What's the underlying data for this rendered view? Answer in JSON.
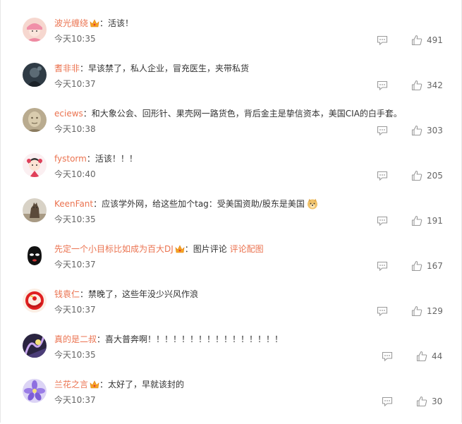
{
  "comments": [
    {
      "user": "波光缠绕",
      "vip": true,
      "colon": "：",
      "text": "活该！",
      "link": "",
      "link2": "",
      "time": "今天10:35",
      "likes": "491",
      "avatar": "avatar-girl-pink-hat"
    },
    {
      "user": "耆非非",
      "vip": false,
      "colon": "：",
      "text": "早该禁了，私人企业，冒充医生，夹带私货",
      "link": "",
      "link2": "",
      "time": "今天10:37",
      "likes": "342",
      "avatar": "avatar-dark-figure"
    },
    {
      "user": "eciews",
      "vip": false,
      "colon": "：",
      "text": "和大象公会、回形针、果壳网一路货色，背后金主是挚信资本，美国CIA的白手套。",
      "link": "",
      "link2": "",
      "time": "今天10:38",
      "likes": "303",
      "avatar": "avatar-sculpture-face"
    },
    {
      "user": "fystorm",
      "vip": false,
      "colon": "：",
      "text": "活该！！！",
      "link": "",
      "link2": "",
      "time": "今天10:40",
      "likes": "205",
      "avatar": "avatar-cartoon-girl"
    },
    {
      "user": "KeenFant",
      "vip": false,
      "colon": "：",
      "text": "应该学外网，给这些加个tag：受美国资助/股东是美国",
      "link": "",
      "link2": "",
      "time": "今天10:35",
      "likes": "191",
      "avatar": "avatar-cat-photo",
      "emoji": "doge-emoji"
    },
    {
      "user": "先定一个小目标比如成为百大DJ",
      "vip": true,
      "colon": "：",
      "text": "图片评论 ",
      "link": "评论配图",
      "link2": "",
      "time": "今天10:37",
      "likes": "167",
      "avatar": "avatar-masked-face"
    },
    {
      "user": "钱袁仁",
      "vip": false,
      "colon": "：",
      "text": "禁晚了，这些年没少兴风作浪",
      "link": "",
      "link2": "",
      "time": "今天10:37",
      "likes": "129",
      "avatar": "avatar-red-logo"
    },
    {
      "user": "真的是二叔",
      "vip": false,
      "colon": "：",
      "text": "喜大普奔啊！！！！！！！！！！！！！！！！",
      "link": "",
      "link2": "",
      "time": "今天10:35",
      "likes": "44",
      "avatar": "avatar-purple-abstract"
    },
    {
      "user": "兰花之言",
      "vip": true,
      "colon": "：",
      "text": "太好了，早就该封的",
      "link": "",
      "link2": "",
      "time": "今天10:37",
      "likes": "30",
      "avatar": "avatar-purple-flower"
    }
  ],
  "icons": {
    "reply": "comment-icon",
    "like": "thumbs-up-icon",
    "vip": "vip-crown-icon"
  },
  "colors": {
    "username": "#eb7350",
    "text": "#333333",
    "time": "#666666",
    "icon": "#9a9a9a"
  }
}
